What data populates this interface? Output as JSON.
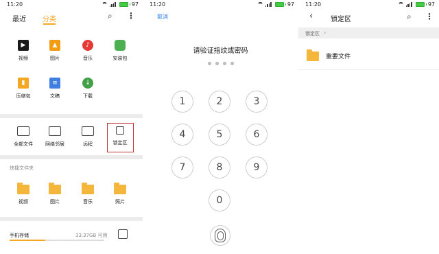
{
  "status": {
    "time": "11:20",
    "battery": "97"
  },
  "screen1": {
    "tabs": [
      "最近",
      "分类"
    ],
    "categories": [
      "视频",
      "图片",
      "音乐",
      "安装包",
      "压缩包",
      "文稿",
      "下载"
    ],
    "locations": [
      "全部文件",
      "网络邻居",
      "远程",
      "锁定区"
    ],
    "quick_title": "快捷文件夹",
    "quick_folders": [
      "视频",
      "图片",
      "音乐",
      "照片"
    ],
    "storage": {
      "label": "手机存储",
      "free": "33.37GB 可用",
      "used_fraction": 0.38
    }
  },
  "screen2": {
    "cancel": "取消",
    "title": "请验证指纹或密码",
    "keys": [
      "1",
      "2",
      "3",
      "4",
      "5",
      "6",
      "7",
      "8",
      "9",
      "0"
    ]
  },
  "screen3": {
    "title": "锁定区",
    "breadcrumb": "锁定区",
    "breadcrumb_sep": "›",
    "files": [
      "重要文件"
    ]
  },
  "icons": {
    "search": "⌕",
    "more": "⋮",
    "back": "‹"
  },
  "colors": {
    "accent": "#f5a623",
    "link": "#2b7de9",
    "highlight_box": "#bb3333"
  }
}
